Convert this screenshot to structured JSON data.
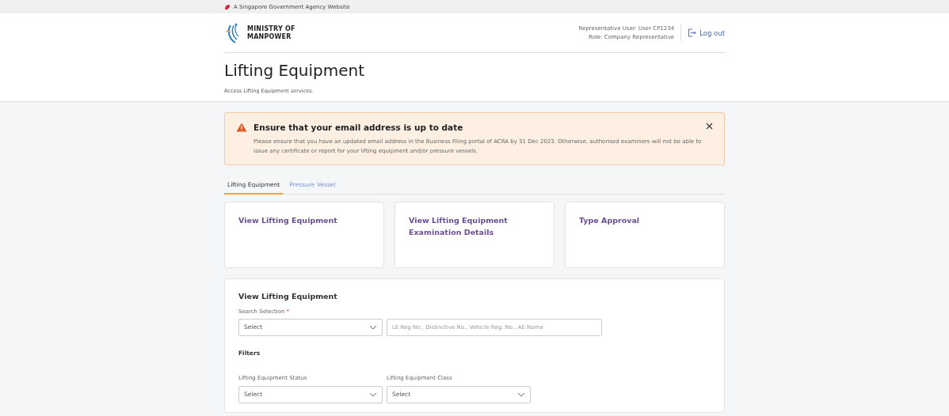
{
  "gov_banner": {
    "text": "A Singapore Government Agency Website"
  },
  "header": {
    "logo_line1": "MINISTRY OF",
    "logo_line2": "MANPOWER",
    "user": "Representative User: User CP1234",
    "role": "Role: Company Representative",
    "logout": "Log out"
  },
  "page": {
    "title": "Lifting Equipment",
    "subtitle": "Access Lifting Equipment services."
  },
  "alert": {
    "title": "Ensure that your email address is up to date",
    "message": "Please ensure that you have an updated email address in the Business Filing portal of ACRA by 31 Dec 2023. Otherwise, authorised examiners will not be able to issue any certificate or report for your lifting equipment and/or pressure vessels."
  },
  "tabs": [
    {
      "label": "Lifting Equipment",
      "selected": true
    },
    {
      "label": "Pressure Vessel",
      "selected": false
    }
  ],
  "cards": [
    {
      "title": "View Lifting Equipment"
    },
    {
      "title": "View Lifting Equipment Examination Details"
    },
    {
      "title": "Type Approval"
    }
  ],
  "form": {
    "title": "View Lifting Equipment",
    "search_label": "Search Selection",
    "required_mark": "*",
    "search_select": "Select",
    "search_input": {
      "placeholder": "LE Reg No., Distinctive No., Vehicle Reg. No., AE Name"
    },
    "filters_title": "Filters",
    "filters": [
      {
        "label": "Lifting Equipment Status",
        "value": "Select"
      },
      {
        "label": "Lifting Equipment Class",
        "value": "Select"
      }
    ]
  }
}
